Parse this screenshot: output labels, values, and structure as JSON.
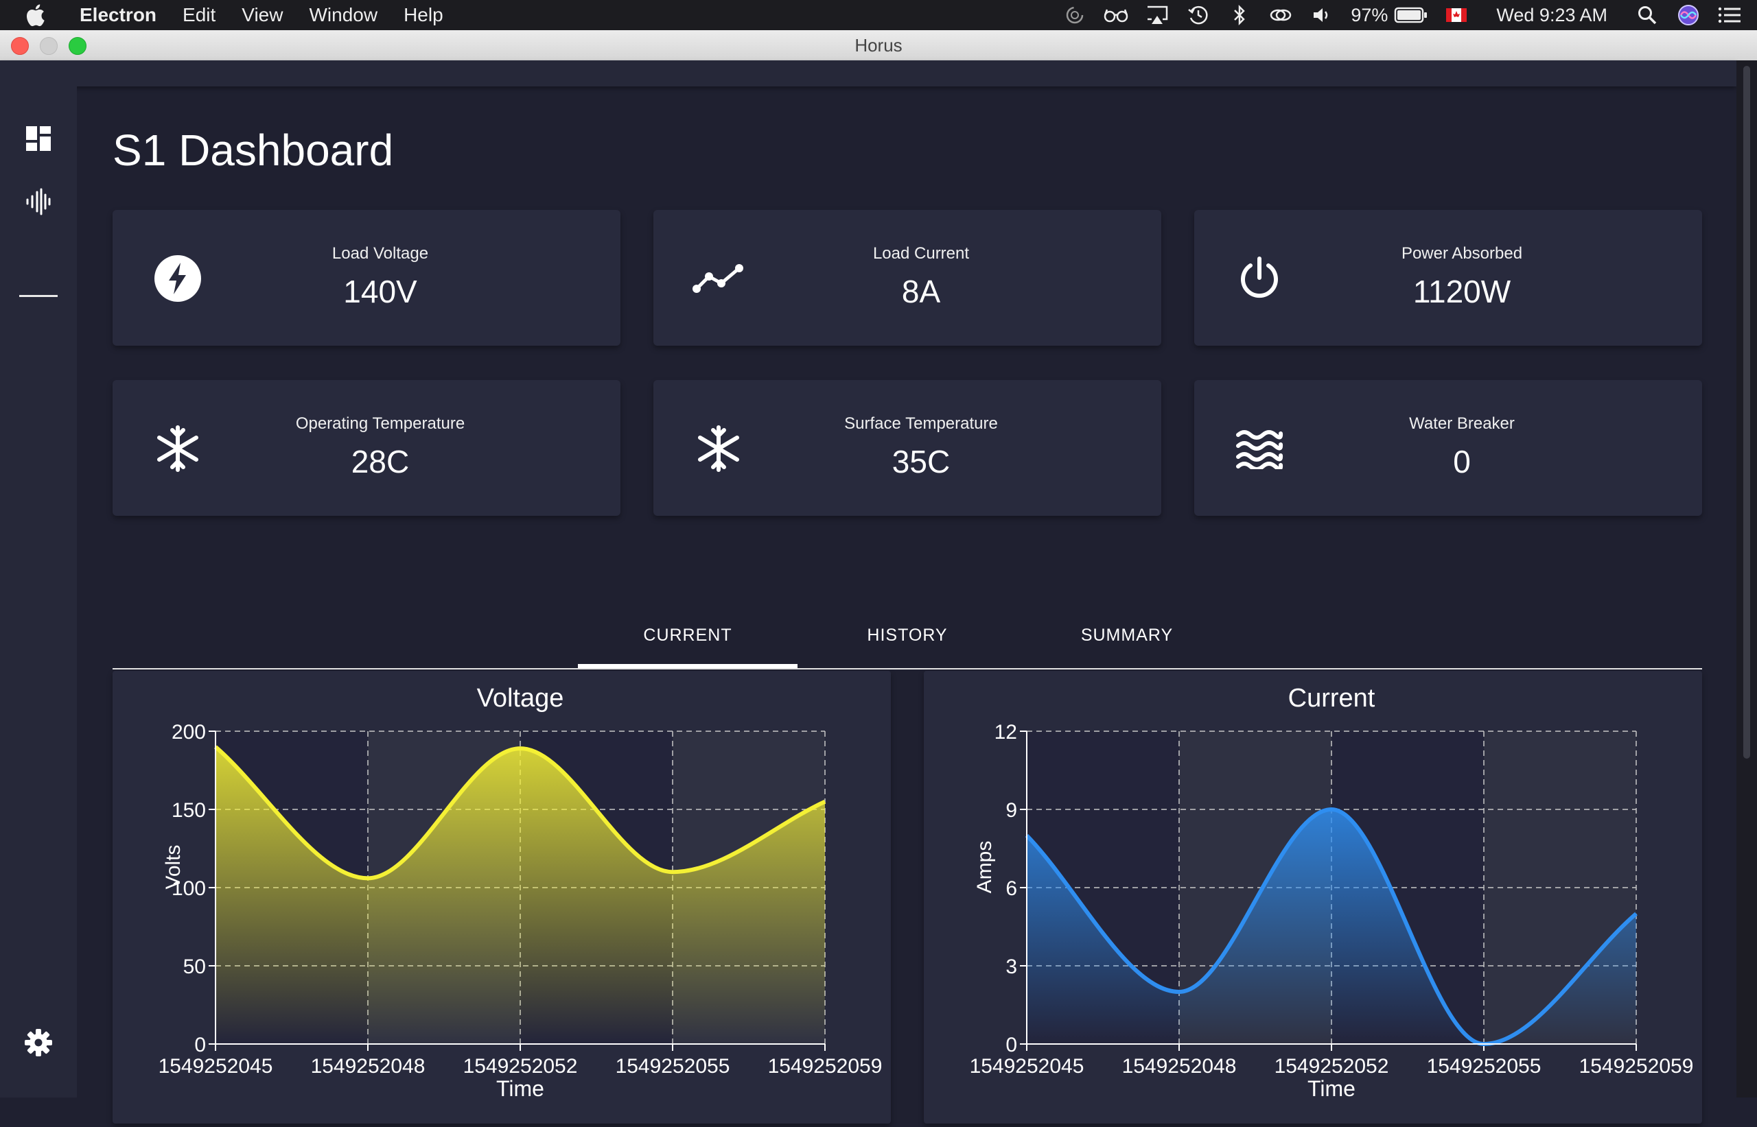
{
  "menubar": {
    "app_name": "Electron",
    "menus": [
      "Edit",
      "View",
      "Window",
      "Help"
    ],
    "battery": "97%",
    "clock": "Wed 9:23 AM"
  },
  "window": {
    "title": "Horus"
  },
  "sidebar": {
    "items": [
      {
        "name": "dashboard",
        "icon": "dashboard-icon"
      },
      {
        "name": "signal",
        "icon": "waveform-icon"
      },
      {
        "name": "settings",
        "icon": "gear-icon"
      }
    ]
  },
  "page": {
    "title": "S1 Dashboard"
  },
  "cards": [
    {
      "label": "Load Voltage",
      "value": "140V",
      "icon": "lightning-icon"
    },
    {
      "label": "Load Current",
      "value": "8A",
      "icon": "trend-line-icon"
    },
    {
      "label": "Power Absorbed",
      "value": "1120W",
      "icon": "power-icon"
    },
    {
      "label": "Operating Temperature",
      "value": "28C",
      "icon": "snowflake-icon"
    },
    {
      "label": "Surface Temperature",
      "value": "35C",
      "icon": "snowflake-icon"
    },
    {
      "label": "Water Breaker",
      "value": "0",
      "icon": "waves-icon"
    }
  ],
  "tabs": {
    "items": [
      "CURRENT",
      "HISTORY",
      "SUMMARY"
    ],
    "active": "CURRENT"
  },
  "colors": {
    "voltage_line": "#f4f035",
    "current_line": "#2f8ef0",
    "card_bg": "#282a3d",
    "page_bg": "#1f2030"
  },
  "chart_data": [
    {
      "type": "area",
      "title": "Voltage",
      "xlabel": "Time",
      "ylabel": "Volts",
      "x_ticks": [
        "1549252045",
        "1549252048",
        "1549252052",
        "1549252055",
        "1549252059"
      ],
      "y_ticks": [
        "0",
        "50",
        "100",
        "150",
        "200"
      ],
      "ylim": [
        0,
        200
      ],
      "grid": true,
      "series": [
        {
          "values": [
            190,
            106,
            189,
            110,
            155
          ]
        }
      ]
    },
    {
      "type": "area",
      "title": "Current",
      "xlabel": "Time",
      "ylabel": "Amps",
      "x_ticks": [
        "1549252045",
        "1549252048",
        "1549252052",
        "1549252055",
        "1549252059"
      ],
      "y_ticks": [
        "0",
        "3",
        "6",
        "9",
        "12"
      ],
      "ylim": [
        0,
        12
      ],
      "grid": true,
      "series": [
        {
          "values": [
            8,
            2,
            9,
            0,
            5
          ]
        }
      ]
    }
  ]
}
